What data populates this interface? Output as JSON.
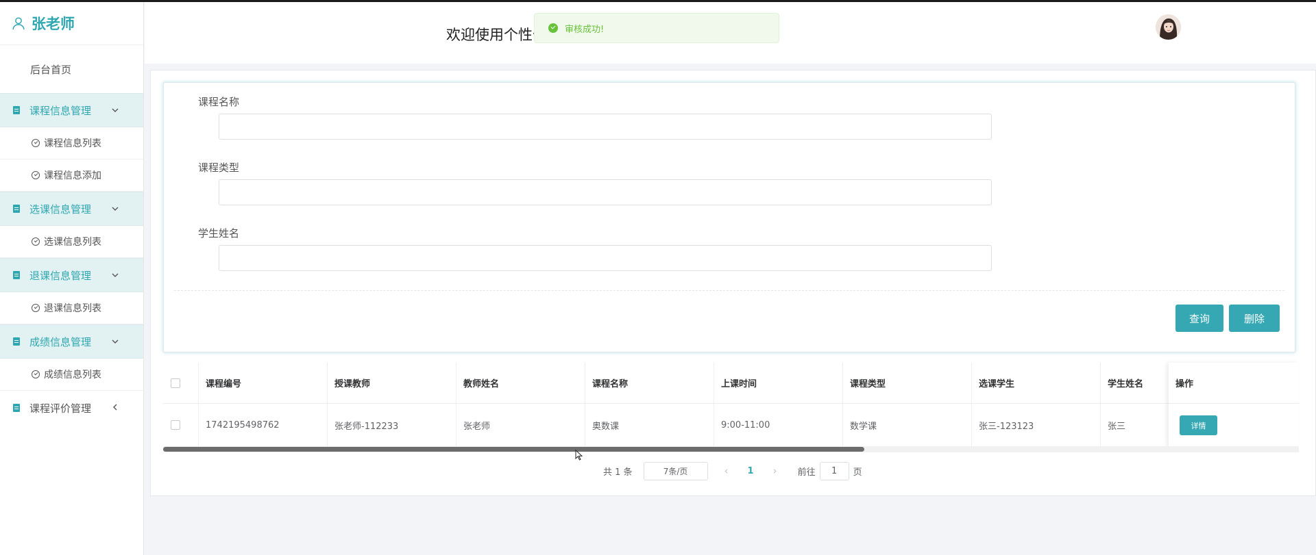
{
  "app": {
    "user_name": "张老师",
    "welcome_text": "欢迎使用个性化",
    "accent_color": "#35a8b3"
  },
  "toast": {
    "message": "审核成功!",
    "color": "#67c23a"
  },
  "sidebar": {
    "home": "后台首页",
    "groups": [
      {
        "label": "课程信息管理",
        "items": [
          "课程信息列表",
          "课程信息添加"
        ]
      },
      {
        "label": "选课信息管理",
        "items": [
          "选课信息列表"
        ]
      },
      {
        "label": "退课信息管理",
        "items": [
          "退课信息列表"
        ]
      },
      {
        "label": "成绩信息管理",
        "items": [
          "成绩信息列表"
        ]
      },
      {
        "label": "课程评价管理",
        "items": []
      }
    ]
  },
  "search": {
    "fields": [
      {
        "label": "课程名称",
        "value": ""
      },
      {
        "label": "课程类型",
        "value": ""
      },
      {
        "label": "学生姓名",
        "value": ""
      }
    ],
    "query_label": "查询",
    "delete_label": "删除"
  },
  "table": {
    "columns": [
      "课程编号",
      "授课教师",
      "教师姓名",
      "课程名称",
      "上课时间",
      "课程类型",
      "选课学生",
      "学生姓名",
      "操作"
    ],
    "rows": [
      {
        "cells": [
          "1742195498762",
          "张老师-112233",
          "张老师",
          "奥数课",
          "9:00-11:00",
          "数学课",
          "张三-123123",
          "张三"
        ],
        "action": "详情"
      }
    ]
  },
  "pagination": {
    "total": "共 1 条",
    "page_size": "7条/页",
    "current": "1",
    "goto_prefix": "前往",
    "goto_value": "1",
    "goto_suffix": "页"
  }
}
